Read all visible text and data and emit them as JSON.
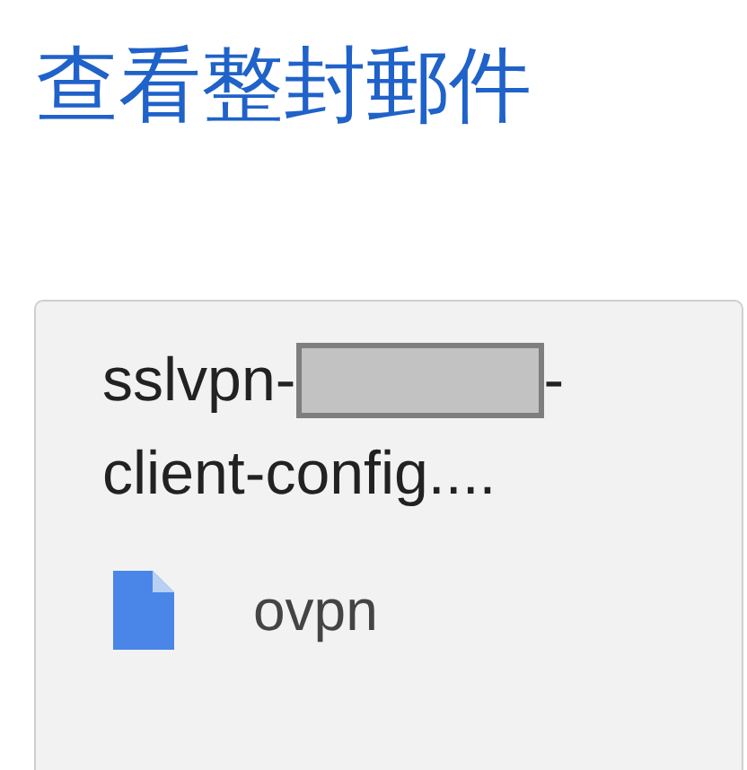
{
  "title": "查看整封郵件",
  "attachment": {
    "name_segments": [
      "sslvpn-",
      "-",
      "client-config...."
    ],
    "redacted": true,
    "extension": "ovpn"
  }
}
